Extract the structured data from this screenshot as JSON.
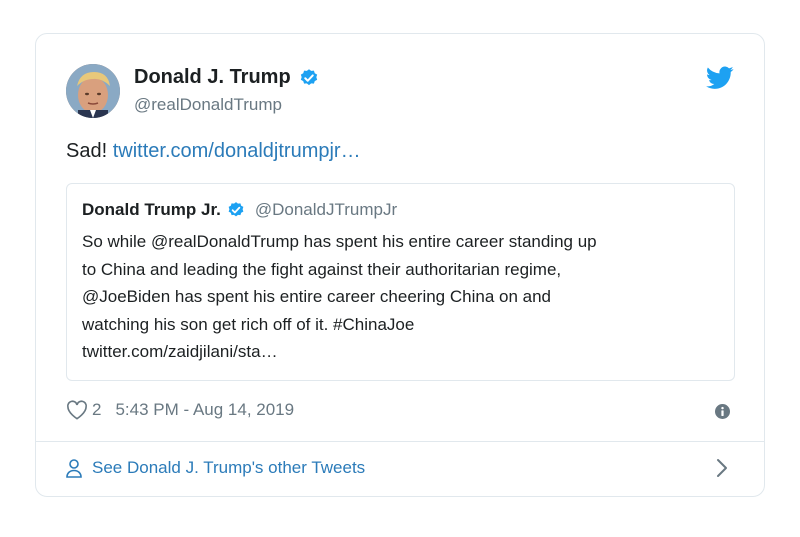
{
  "tweet": {
    "author": {
      "name": "Donald J. Trump",
      "handle": "@realDonaldTrump"
    },
    "text_prefix": "Sad!",
    "link": "twitter.com/donaldjtrumpjr…",
    "quoted": {
      "name": "Donald Trump Jr.",
      "handle": "@DonaldJTrumpJr",
      "lines": [
        "So while @realDonaldTrump has spent his entire career standing up",
        "to China and leading the fight against their authoritarian regime,",
        "@JoeBiden has spent his entire career cheering China on and",
        "watching his son get rich off of it. #ChinaJoe",
        "twitter.com/zaidjilani/sta…"
      ]
    },
    "likes": "2",
    "timestamp": "5:43 PM - Aug 14, 2019",
    "footer_link": "See Donald J. Trump's other Tweets"
  },
  "icons": {
    "verified": "verified-badge-icon",
    "brand": "twitter-bird-icon",
    "like": "heart-icon",
    "info": "info-icon",
    "profile": "person-icon",
    "next": "chevron-right-icon"
  },
  "colors": {
    "link": "#2b7bb9",
    "verified": "#1da1f2",
    "secondary_text": "#697882",
    "border": "#e1e8ed"
  }
}
